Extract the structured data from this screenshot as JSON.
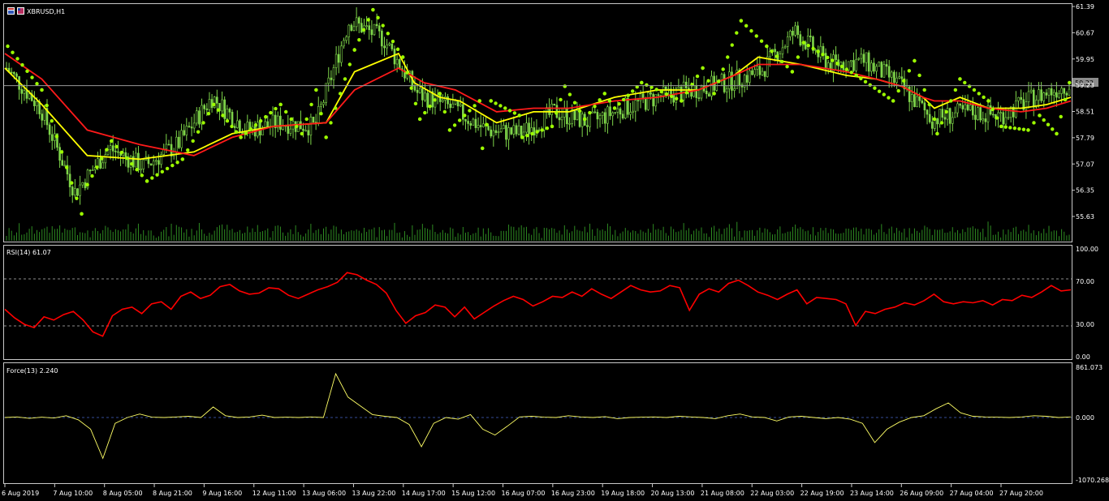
{
  "window": {
    "title": "XBRUSD,H1"
  },
  "colors": {
    "background": "#000000",
    "candle": "#7fd64a",
    "volume": "#2e8b22",
    "psar": "#9dff00",
    "ma_fast": "#ffff00",
    "ma_slow": "#ff1a1a",
    "rsi": "#ff0000",
    "force": "#ffff66",
    "grid": "#c0c0c0"
  },
  "price_panel": {
    "current_price": "59.22",
    "axis_ticks": [
      "61.39",
      "60.67",
      "59.95",
      "59.23",
      "58.51",
      "57.79",
      "57.07",
      "56.35",
      "55.63"
    ]
  },
  "rsi_panel": {
    "label": "RSI(14) 61.07",
    "axis_ticks": [
      "100.00",
      "70.00",
      "30.00",
      "0.00"
    ]
  },
  "force_panel": {
    "label": "Force(13) 2.240",
    "axis_ticks": [
      "861.073",
      "0.000",
      "-1070.268"
    ]
  },
  "time_axis": [
    "6 Aug 2019",
    "7 Aug 10:00",
    "8 Aug 05:00",
    "8 Aug 21:00",
    "9 Aug 16:00",
    "12 Aug 11:00",
    "13 Aug 06:00",
    "13 Aug 22:00",
    "14 Aug 17:00",
    "15 Aug 12:00",
    "16 Aug 07:00",
    "16 Aug 23:00",
    "19 Aug 18:00",
    "20 Aug 13:00",
    "21 Aug 08:00",
    "22 Aug 03:00",
    "22 Aug 19:00",
    "23 Aug 14:00",
    "26 Aug 09:00",
    "27 Aug 04:00",
    "27 Aug 20:00"
  ],
  "chart_data": [
    {
      "type": "candlestick",
      "title": "XBRUSD,H1",
      "xlabel": "",
      "ylabel": "",
      "x": [
        "6 Aug 2019",
        "7 Aug 10:00",
        "8 Aug 05:00",
        "8 Aug 21:00",
        "9 Aug 16:00",
        "12 Aug 11:00",
        "13 Aug 06:00",
        "13 Aug 22:00",
        "14 Aug 17:00",
        "15 Aug 12:00",
        "16 Aug 07:00",
        "16 Aug 23:00",
        "19 Aug 18:00",
        "20 Aug 13:00",
        "21 Aug 08:00",
        "22 Aug 03:00",
        "22 Aug 19:00",
        "23 Aug 14:00",
        "26 Aug 09:00",
        "27 Aug 04:00",
        "27 Aug 20:00"
      ],
      "ylim": [
        55.3,
        61.39
      ],
      "close_path": [
        59.7,
        58.6,
        56.3,
        57.5,
        57.0,
        57.6,
        58.9,
        58.0,
        58.2,
        58.1,
        61.0,
        60.5,
        59.0,
        58.6,
        58.0,
        57.9,
        58.5,
        58.2,
        58.6,
        58.9,
        59.1,
        59.3,
        59.6,
        60.7,
        59.8,
        59.9,
        59.3,
        58.3,
        58.5,
        58.4,
        58.9,
        59.25
      ],
      "series": [
        {
          "name": "Parabolic SAR",
          "points": [
            [
              0.2,
              60.3
            ],
            [
              2.6,
              59.1
            ],
            [
              5.4,
              55.7
            ],
            [
              5.8,
              56.5
            ],
            [
              7.5,
              57.7
            ],
            [
              10.0,
              56.6
            ],
            [
              12.5,
              57.2
            ],
            [
              14.7,
              58.7
            ],
            [
              16.6,
              57.8
            ],
            [
              19.4,
              58.7
            ],
            [
              20.9,
              57.9
            ],
            [
              21.9,
              59.1
            ],
            [
              22.6,
              57.8
            ],
            [
              24.6,
              60.2
            ],
            [
              25.9,
              61.3
            ],
            [
              28.0,
              60.0
            ],
            [
              29.2,
              58.3
            ],
            [
              30.6,
              59.0
            ],
            [
              31.3,
              58.0
            ],
            [
              33.4,
              58.8
            ],
            [
              33.6,
              57.5
            ],
            [
              34.2,
              58.8
            ],
            [
              36.2,
              58.4
            ],
            [
              36.4,
              57.8
            ],
            [
              38.5,
              58.1
            ],
            [
              39.4,
              59.2
            ],
            [
              40.8,
              58.3
            ],
            [
              42.2,
              59.0
            ],
            [
              42.9,
              58.6
            ],
            [
              44.8,
              59.3
            ],
            [
              47.6,
              58.8
            ],
            [
              49.1,
              59.7
            ],
            [
              49.9,
              59.0
            ],
            [
              51.8,
              61.0
            ],
            [
              53.6,
              60.3
            ],
            [
              55.4,
              59.6
            ],
            [
              56.2,
              60.4
            ],
            [
              59.9,
              59.5
            ],
            [
              62.5,
              58.8
            ],
            [
              64.0,
              59.9
            ],
            [
              65.4,
              58.3
            ],
            [
              65.6,
              57.9
            ],
            [
              67.2,
              59.4
            ],
            [
              69.2,
              58.8
            ],
            [
              70.1,
              58.1
            ],
            [
              72.0,
              58.0
            ],
            [
              72.8,
              58.4
            ],
            [
              74.0,
              57.9
            ],
            [
              74.9,
              59.3
            ]
          ]
        },
        {
          "name": "MA fast",
          "points": [
            [
              0,
              59.7
            ],
            [
              2.6,
              58.7
            ],
            [
              5.8,
              57.3
            ],
            [
              9.5,
              57.2
            ],
            [
              13.3,
              57.4
            ],
            [
              16.0,
              57.9
            ],
            [
              18.9,
              58.1
            ],
            [
              22.6,
              58.2
            ],
            [
              24.6,
              59.6
            ],
            [
              27.7,
              60.1
            ],
            [
              28.8,
              59.3
            ],
            [
              30.6,
              58.9
            ],
            [
              32.0,
              58.8
            ],
            [
              34.6,
              58.2
            ],
            [
              37.2,
              58.5
            ],
            [
              39.7,
              58.5
            ],
            [
              42.9,
              58.9
            ],
            [
              45.9,
              59.1
            ],
            [
              48.8,
              59.1
            ],
            [
              51.3,
              59.5
            ],
            [
              53.0,
              60.0
            ],
            [
              56.0,
              59.8
            ],
            [
              59.2,
              59.5
            ],
            [
              61.3,
              59.4
            ],
            [
              63.1,
              59.2
            ],
            [
              64.6,
              58.9
            ],
            [
              65.4,
              58.6
            ],
            [
              67.2,
              58.9
            ],
            [
              69.2,
              58.6
            ],
            [
              71.5,
              58.6
            ],
            [
              73.3,
              58.7
            ],
            [
              75,
              58.9
            ]
          ]
        },
        {
          "name": "MA slow",
          "points": [
            [
              0,
              60.1
            ],
            [
              2.6,
              59.4
            ],
            [
              5.8,
              58.0
            ],
            [
              9.5,
              57.6
            ],
            [
              13.3,
              57.3
            ],
            [
              16.0,
              57.8
            ],
            [
              18.9,
              58.1
            ],
            [
              22.6,
              58.2
            ],
            [
              24.6,
              59.1
            ],
            [
              27.7,
              59.7
            ],
            [
              29.5,
              59.3
            ],
            [
              31.7,
              59.1
            ],
            [
              34.6,
              58.5
            ],
            [
              37.2,
              58.6
            ],
            [
              39.7,
              58.6
            ],
            [
              42.9,
              58.8
            ],
            [
              45.9,
              58.9
            ],
            [
              48.8,
              59.1
            ],
            [
              51.3,
              59.5
            ],
            [
              53.0,
              59.8
            ],
            [
              56.0,
              59.8
            ],
            [
              59.2,
              59.6
            ],
            [
              61.3,
              59.4
            ],
            [
              63.1,
              59.2
            ],
            [
              64.6,
              58.9
            ],
            [
              65.4,
              58.8
            ],
            [
              67.2,
              58.8
            ],
            [
              69.2,
              58.6
            ],
            [
              71.5,
              58.5
            ],
            [
              73.3,
              58.6
            ],
            [
              75,
              58.8
            ]
          ]
        }
      ]
    },
    {
      "type": "line",
      "title": "RSI(14) 61.07",
      "ylim": [
        0,
        100
      ],
      "series": [
        {
          "name": "RSI",
          "values": [
            44,
            36,
            30,
            27,
            37,
            34,
            39,
            42,
            34,
            23,
            19,
            38,
            44,
            46,
            40,
            49,
            51,
            44,
            56,
            60,
            54,
            57,
            65,
            67,
            61,
            58,
            59,
            64,
            63,
            57,
            54,
            58,
            62,
            65,
            69,
            78,
            76,
            71,
            67,
            59,
            43,
            31,
            38,
            41,
            48,
            46,
            37,
            46,
            35,
            41,
            47,
            52,
            56,
            53,
            47,
            51,
            56,
            55,
            60,
            56,
            63,
            58,
            54,
            60,
            66,
            62,
            60,
            61,
            66,
            64,
            43,
            58,
            63,
            60,
            68,
            71,
            66,
            60,
            57,
            53,
            58,
            62,
            49,
            55,
            54,
            53,
            49,
            29,
            42,
            40,
            44,
            46,
            50,
            48,
            52,
            58,
            51,
            49,
            51,
            50,
            52,
            48,
            53,
            52,
            57,
            55,
            60,
            66,
            61,
            62
          ]
        }
      ],
      "reference_lines": [
        70,
        30
      ]
    },
    {
      "type": "line",
      "title": "Force(13) 2.240",
      "ylim": [
        -1070.268,
        861.073
      ],
      "series": [
        {
          "name": "Force",
          "values": [
            0,
            10,
            -15,
            5,
            -10,
            30,
            -40,
            -200,
            -700,
            -100,
            0,
            60,
            5,
            0,
            10,
            20,
            0,
            180,
            30,
            0,
            10,
            40,
            0,
            5,
            0,
            10,
            0,
            750,
            350,
            200,
            50,
            20,
            0,
            -120,
            -500,
            -100,
            0,
            -30,
            50,
            -200,
            -300,
            -150,
            10,
            20,
            5,
            0,
            30,
            10,
            0,
            15,
            -20,
            0,
            5,
            10,
            0,
            20,
            10,
            0,
            -20,
            30,
            60,
            10,
            0,
            -60,
            10,
            20,
            0,
            -20,
            0,
            -30,
            -100,
            -430,
            -200,
            -80,
            0,
            30,
            150,
            250,
            80,
            20,
            10,
            5,
            0,
            10,
            30,
            20,
            0,
            10
          ]
        }
      ],
      "reference_lines": [
        0
      ]
    }
  ]
}
